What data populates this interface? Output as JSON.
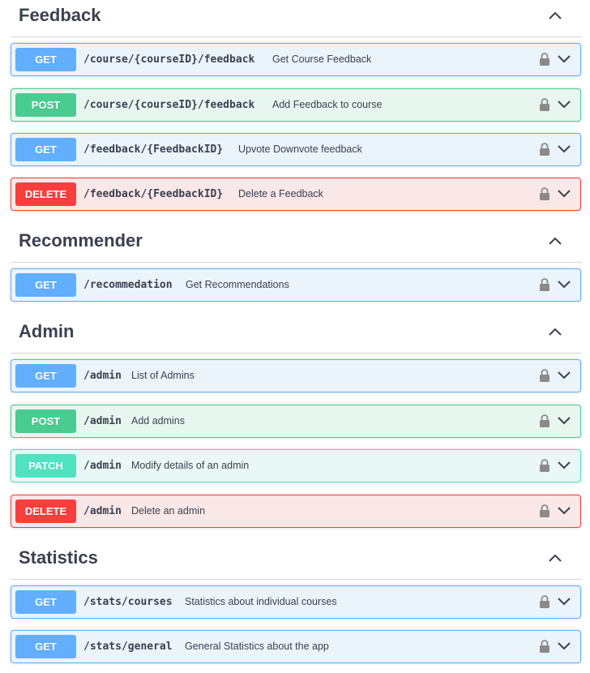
{
  "icons": {
    "section_toggle": "chevron-up-icon",
    "lock": "lock-icon",
    "expand": "chevron-down-icon"
  },
  "colors": {
    "get": "#61affe",
    "post": "#49cc90",
    "delete": "#f93e3e",
    "patch": "#50e3c2"
  },
  "sections": [
    {
      "title": "Feedback",
      "operations": [
        {
          "method": "GET",
          "path": "/course/{courseID}/feedback",
          "summary": "Get Course Feedback"
        },
        {
          "method": "POST",
          "path": "/course/{courseID}/feedback",
          "summary": "Add Feedback to course"
        },
        {
          "method": "GET",
          "path": "/feedback/{FeedbackID}",
          "summary": "Upvote Downvote feedback"
        },
        {
          "method": "DELETE",
          "path": "/feedback/{FeedbackID}",
          "summary": "Delete a Feedback"
        }
      ]
    },
    {
      "title": "Recommender",
      "operations": [
        {
          "method": "GET",
          "path": "/recommedation",
          "summary": "Get Recommendations"
        }
      ]
    },
    {
      "title": "Admin",
      "operations": [
        {
          "method": "GET",
          "path": "/admin",
          "summary": "List of Admins"
        },
        {
          "method": "POST",
          "path": "/admin",
          "summary": "Add admins"
        },
        {
          "method": "PATCH",
          "path": "/admin",
          "summary": "Modify details of an admin"
        },
        {
          "method": "DELETE",
          "path": "/admin",
          "summary": "Delete an admin"
        }
      ]
    },
    {
      "title": "Statistics",
      "operations": [
        {
          "method": "GET",
          "path": "/stats/courses",
          "summary": "Statistics about individual courses"
        },
        {
          "method": "GET",
          "path": "/stats/general",
          "summary": "General Statistics about the app"
        }
      ]
    }
  ]
}
